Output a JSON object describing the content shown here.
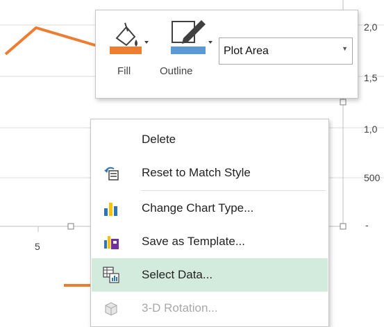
{
  "chart": {
    "right_axis_labels": [
      "2,0",
      "1,5",
      "1,0",
      "500",
      "-"
    ],
    "x_axis_label": "5",
    "series_color": "#ed7d31"
  },
  "minibar": {
    "fill_label": "Fill",
    "outline_label": "Outline",
    "fill_color": "#ed7d31",
    "outline_color": "#5b9bd5",
    "element_select": "Plot Area"
  },
  "context_menu": {
    "items": [
      {
        "label": "Delete",
        "icon": "",
        "disabled": false,
        "highlighted": false
      },
      {
        "label": "Reset to Match Style",
        "icon": "reset-style-icon",
        "disabled": false,
        "highlighted": false
      },
      {
        "label": "Change Chart Type...",
        "icon": "bar-chart-icon",
        "disabled": false,
        "highlighted": false
      },
      {
        "label": "Save as Template...",
        "icon": "template-icon",
        "disabled": false,
        "highlighted": false
      },
      {
        "label": "Select Data...",
        "icon": "select-data-icon",
        "disabled": false,
        "highlighted": true
      },
      {
        "label": "3-D Rotation...",
        "icon": "cube-icon",
        "disabled": true,
        "highlighted": false
      }
    ],
    "highlight_color": "#d3ebdc"
  }
}
